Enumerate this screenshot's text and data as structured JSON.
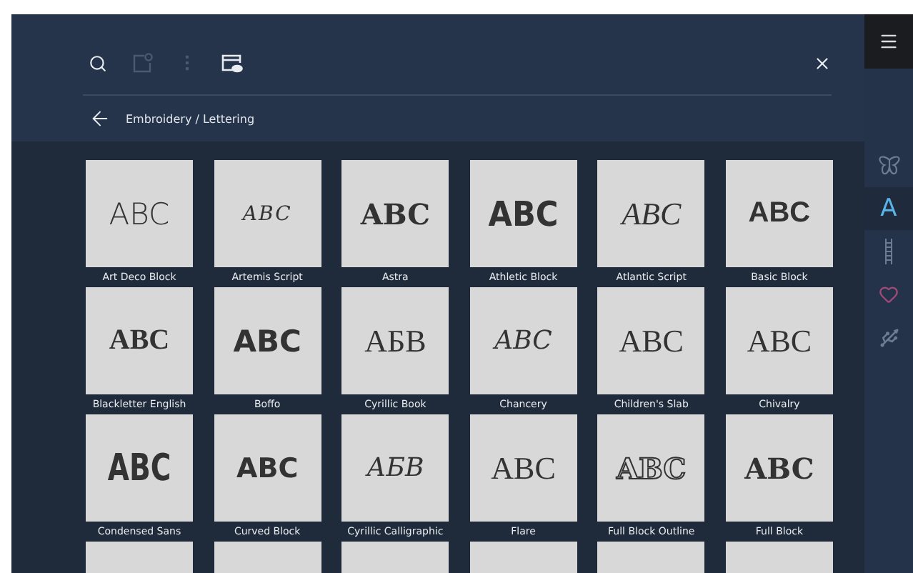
{
  "toolbar": {
    "actions": [
      {
        "kind": "search",
        "disabled": false
      },
      {
        "kind": "add-note",
        "disabled": true
      },
      {
        "kind": "more",
        "disabled": true
      },
      {
        "kind": "preview",
        "disabled": false
      }
    ]
  },
  "breadcrumb": "Embroidery / Lettering",
  "fonts": [
    {
      "name": "Art Deco Block",
      "sample": "ABC",
      "kind": "deco"
    },
    {
      "name": "Artemis Script",
      "sample": "ABC",
      "kind": "fancy-script"
    },
    {
      "name": "Astra",
      "sample": "ABC",
      "kind": "bold-serif"
    },
    {
      "name": "Athletic Block",
      "sample": "ABC",
      "kind": "heavy"
    },
    {
      "name": "Atlantic Script",
      "sample": "ABC",
      "kind": "script"
    },
    {
      "name": "Basic Block",
      "sample": "ABC",
      "kind": "sans"
    },
    {
      "name": "Blackletter English",
      "sample": "ABC",
      "kind": "blackletter"
    },
    {
      "name": "Boffo",
      "sample": "ABC",
      "kind": "rounded"
    },
    {
      "name": "Cyrillic Book",
      "sample": "АБВ",
      "kind": "serif"
    },
    {
      "name": "Chancery",
      "sample": "ABC",
      "kind": "italic-serif"
    },
    {
      "name": "Children's Slab",
      "sample": "ABC",
      "kind": "serif"
    },
    {
      "name": "Chivalry",
      "sample": "ABC",
      "kind": "serif"
    },
    {
      "name": "Condensed Sans",
      "sample": "ABC",
      "kind": "condensed"
    },
    {
      "name": "Curved Block",
      "sample": "ABC",
      "kind": "bold-sans"
    },
    {
      "name": "Cyrillic Calligraphic",
      "sample": "АБВ",
      "kind": "italic-serif"
    },
    {
      "name": "Flare",
      "sample": "ABC",
      "kind": "serif"
    },
    {
      "name": "Full Block Outline",
      "sample": "ABC",
      "kind": "outline"
    },
    {
      "name": "Full Block",
      "sample": "ABC",
      "kind": "bold-serif"
    }
  ],
  "sidebar": [
    {
      "kind": "butterfly",
      "selected": false
    },
    {
      "kind": "lettering",
      "glyph": "A",
      "selected": true
    },
    {
      "kind": "stitches",
      "selected": false
    },
    {
      "kind": "heart",
      "selected": false
    },
    {
      "kind": "usb",
      "selected": false
    }
  ]
}
